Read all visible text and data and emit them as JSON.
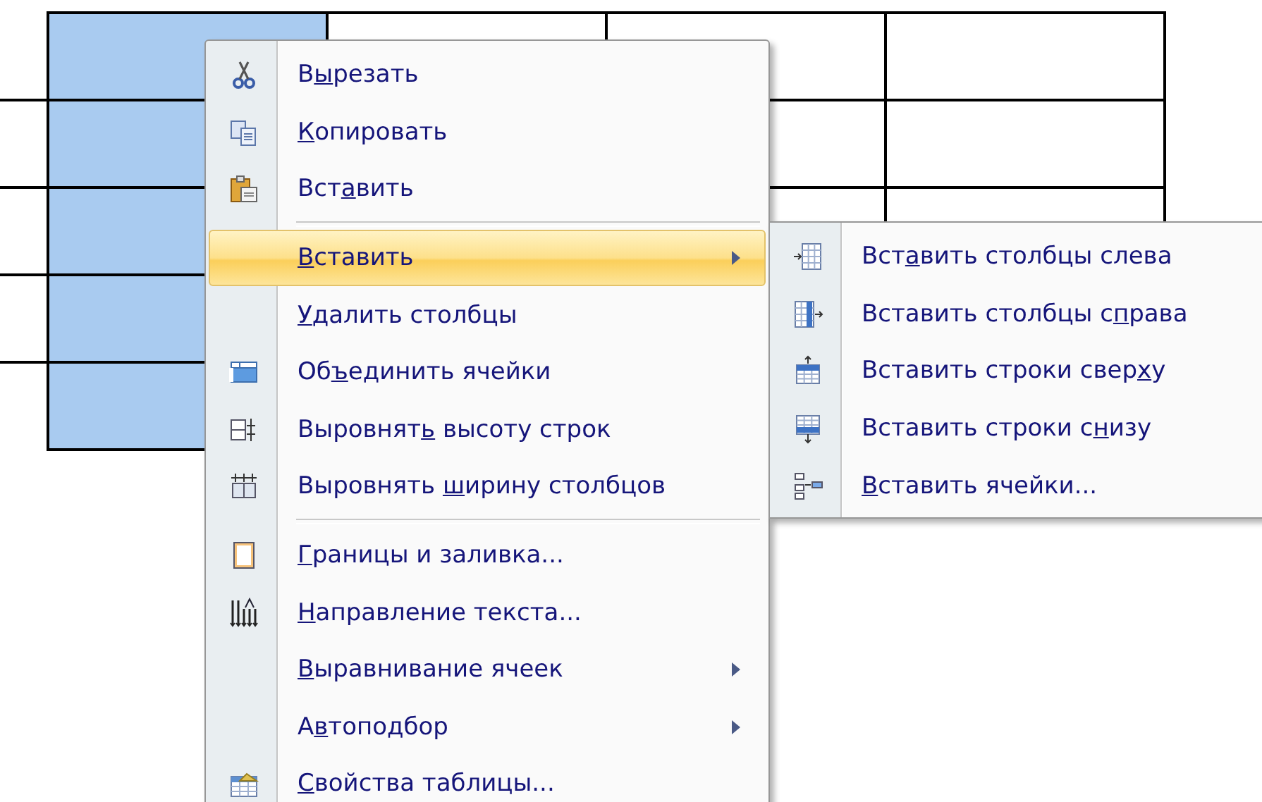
{
  "table": {
    "columns": [
      {
        "selected": true
      },
      {
        "selected": false
      },
      {
        "selected": false
      },
      {
        "selected": false
      }
    ]
  },
  "context_menu": {
    "items": [
      {
        "kind": "command",
        "pre": "В",
        "key": "ы",
        "post": "резать",
        "has_submenu": false,
        "selected": false
      },
      {
        "kind": "command",
        "key": "К",
        "post": "опировать",
        "has_submenu": false,
        "selected": false
      },
      {
        "kind": "command",
        "pre": "Вст",
        "key": "а",
        "post": "вить",
        "has_submenu": false,
        "selected": false
      },
      {
        "kind": "separator"
      },
      {
        "kind": "command",
        "key": "В",
        "post": "ставить",
        "has_submenu": true,
        "selected": true
      },
      {
        "kind": "command",
        "key": "У",
        "post": "далить столбцы",
        "has_submenu": false,
        "selected": false
      },
      {
        "kind": "command",
        "pre": "Об",
        "key": "ъ",
        "post": "единить ячейки",
        "has_submenu": false,
        "selected": false
      },
      {
        "kind": "command",
        "pre": "Выровнят",
        "key": "ь",
        "post": " высоту строк",
        "has_submenu": false,
        "selected": false
      },
      {
        "kind": "command",
        "pre": "Выровнять ",
        "key": "ш",
        "post": "ирину столбцов",
        "has_submenu": false,
        "selected": false
      },
      {
        "kind": "separator"
      },
      {
        "kind": "command",
        "key": "Г",
        "post": "раницы и заливка...",
        "has_submenu": false,
        "selected": false
      },
      {
        "kind": "command",
        "key": "Н",
        "post": "аправление текста...",
        "has_submenu": false,
        "selected": false
      },
      {
        "kind": "command",
        "key": "В",
        "post": "ыравнивание ячеек",
        "has_submenu": true,
        "selected": false
      },
      {
        "kind": "command",
        "pre": "А",
        "key": "в",
        "post": "топодбор",
        "has_submenu": true,
        "selected": false
      },
      {
        "kind": "command",
        "key": "С",
        "post": "войства таблицы...",
        "has_submenu": false,
        "selected": false
      }
    ]
  },
  "submenu": {
    "items": [
      {
        "pre": "Вст",
        "key": "а",
        "post": "вить столбцы слева",
        "selected": false
      },
      {
        "pre": "Вставить столбцы с",
        "key": "п",
        "post": "рава",
        "selected": false
      },
      {
        "pre": "Вставить строки свер",
        "key": "х",
        "post": "у",
        "selected": false
      },
      {
        "pre": "Вставить строки с",
        "key": "н",
        "post": "изу",
        "selected": false
      },
      {
        "key": "В",
        "post": "ставить ячейки...",
        "selected": false
      }
    ]
  }
}
